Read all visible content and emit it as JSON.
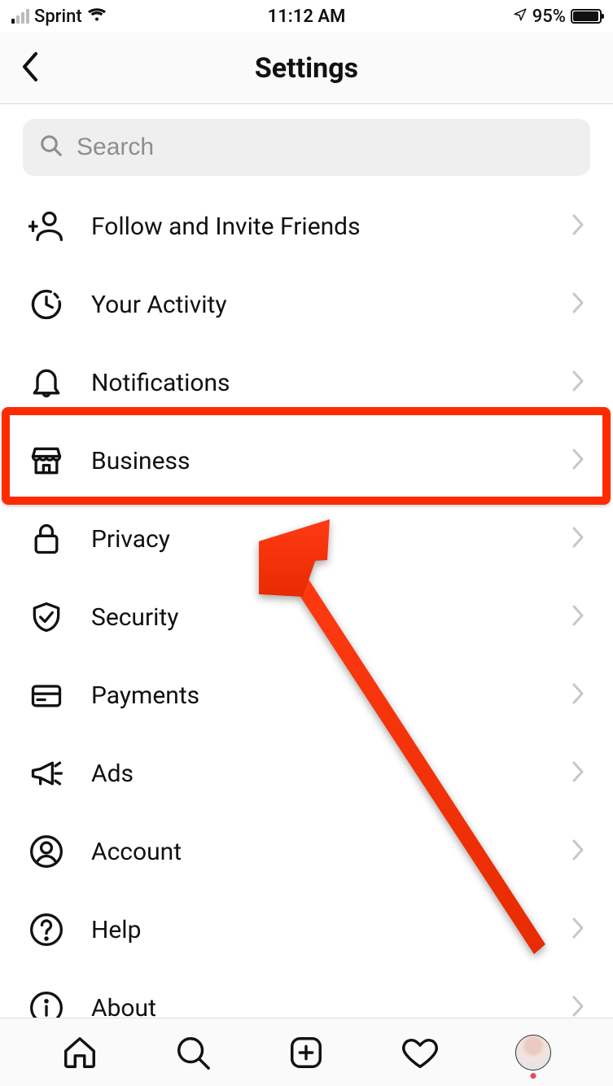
{
  "status": {
    "carrier": "Sprint",
    "time": "11:12 AM",
    "battery_pct": "95%"
  },
  "header": {
    "title": "Settings"
  },
  "search": {
    "placeholder": "Search"
  },
  "menu": {
    "items": [
      {
        "id": "follow-invite",
        "label": "Follow and Invite Friends",
        "icon": "person-add-icon"
      },
      {
        "id": "activity",
        "label": "Your Activity",
        "icon": "clock-icon"
      },
      {
        "id": "notifications",
        "label": "Notifications",
        "icon": "bell-icon"
      },
      {
        "id": "business",
        "label": "Business",
        "icon": "storefront-icon"
      },
      {
        "id": "privacy",
        "label": "Privacy",
        "icon": "lock-icon"
      },
      {
        "id": "security",
        "label": "Security",
        "icon": "shield-check-icon"
      },
      {
        "id": "payments",
        "label": "Payments",
        "icon": "card-icon"
      },
      {
        "id": "ads",
        "label": "Ads",
        "icon": "megaphone-icon"
      },
      {
        "id": "account",
        "label": "Account",
        "icon": "user-circle-icon"
      },
      {
        "id": "help",
        "label": "Help",
        "icon": "help-circle-icon"
      },
      {
        "id": "about",
        "label": "About",
        "icon": "info-circle-icon"
      }
    ]
  },
  "annotation": {
    "highlight_item_id": "business",
    "highlight_color": "#ff2b00"
  },
  "tabs": {
    "items": [
      "home",
      "search",
      "create",
      "activity",
      "profile"
    ]
  }
}
